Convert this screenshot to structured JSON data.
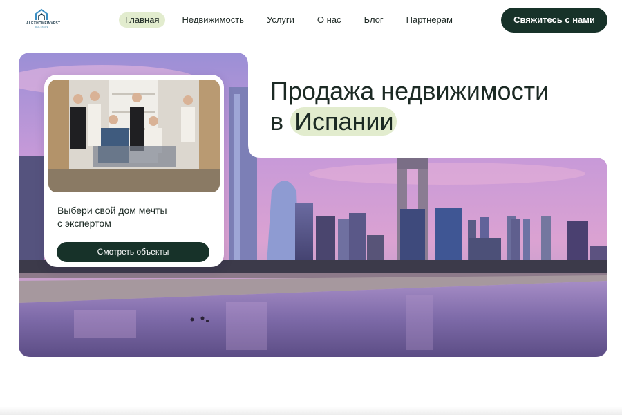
{
  "header": {
    "logo_text": "ALEXHOMEINVEST",
    "logo_sub": "REAL ESTATE",
    "nav": [
      {
        "label": "Главная",
        "active": true
      },
      {
        "label": "Недвижимость",
        "active": false
      },
      {
        "label": "Услуги",
        "active": false
      },
      {
        "label": "О нас",
        "active": false
      },
      {
        "label": "Блог",
        "active": false
      },
      {
        "label": "Партнерам",
        "active": false
      }
    ],
    "cta_label": "Свяжитесь с нами"
  },
  "hero": {
    "title_line1": "Продажа недвижимости",
    "title_line2_prefix": "в",
    "title_line2_highlight": "Испании",
    "image": "benidorm-skyline-sunset-photo"
  },
  "card": {
    "image": "team-photo",
    "text_line1": "Выбери свой дом мечты",
    "text_line2": "с экспертом",
    "button_label": "Смотреть объекты"
  },
  "colors": {
    "accent_dark": "#173229",
    "highlight": "#e2ecce",
    "sky_top": "#9b8fd6",
    "sky_bottom": "#d99ad6"
  }
}
